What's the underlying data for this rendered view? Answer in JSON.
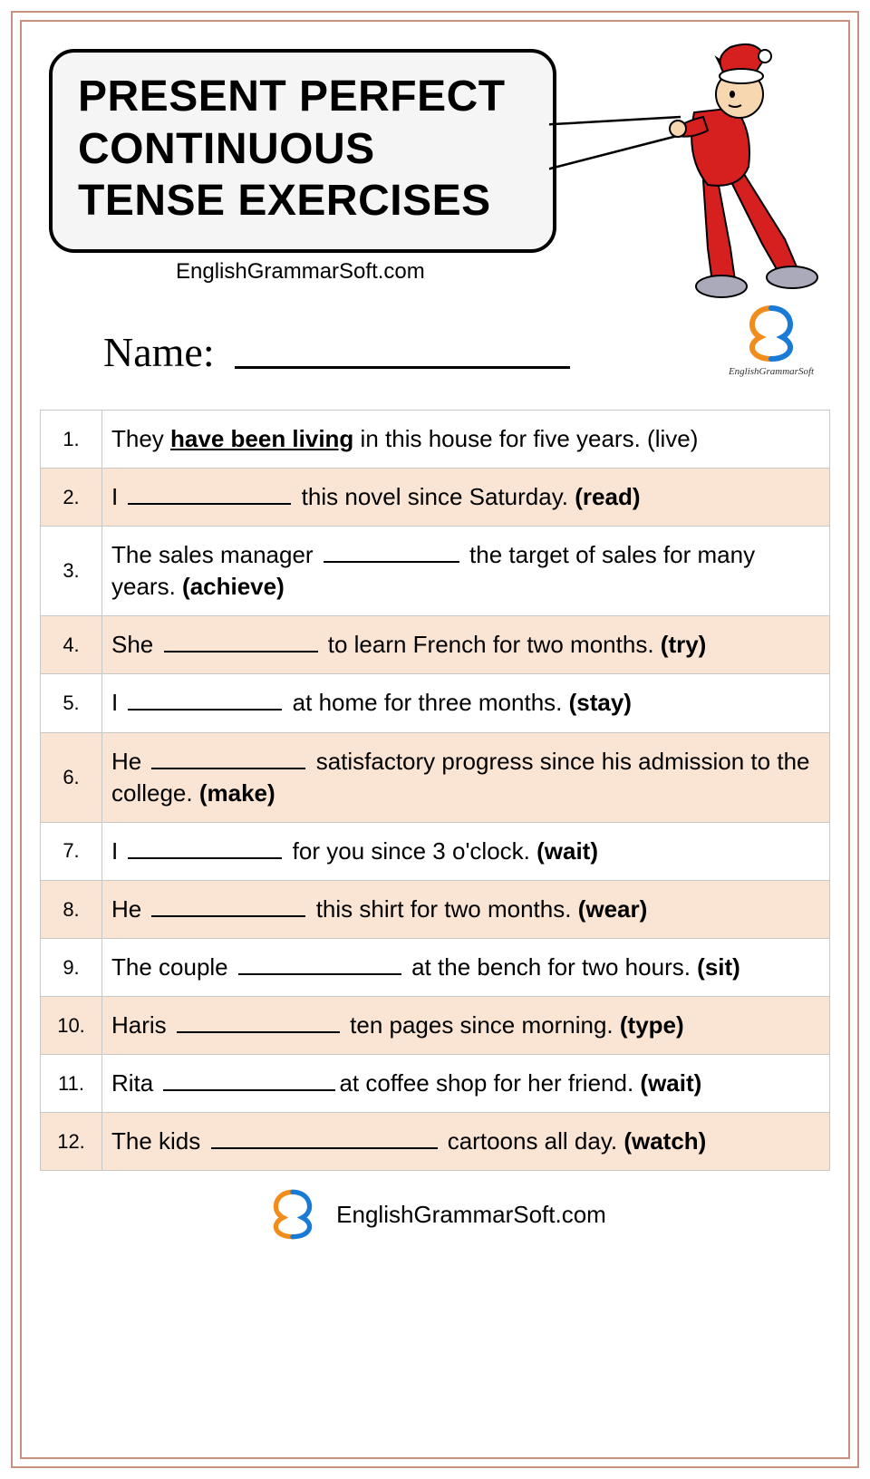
{
  "title": {
    "line1": "PRESENT PERFECT",
    "line2": "CONTINUOUS",
    "line3": "TENSE EXERCISES"
  },
  "website_top": "EnglishGrammarSoft.com",
  "name_label": "Name:",
  "logo_caption": "EnglishGrammarSoft",
  "questions": [
    {
      "n": "1.",
      "pre": "They ",
      "answer": "have been living",
      "post": " in this house for five years. ",
      "verb": "(live)",
      "verb_bold": false,
      "blank_w": 0,
      "example": true
    },
    {
      "n": "2.",
      "pre": "I ",
      "post": " this novel since Saturday. ",
      "verb": "(read)",
      "verb_bold": true,
      "blank_w": 180,
      "example": false
    },
    {
      "n": "3.",
      "pre": "The sales manager ",
      "post": " the target of sales for many years. ",
      "verb": "(achieve)",
      "verb_bold": true,
      "blank_w": 150,
      "example": false
    },
    {
      "n": "4.",
      "pre": "She ",
      "post": " to learn French for two months. ",
      "verb": "(try)",
      "verb_bold": true,
      "blank_w": 170,
      "example": false
    },
    {
      "n": "5.",
      "pre": "I ",
      "post": " at home for three months. ",
      "verb": "(stay)",
      "verb_bold": true,
      "blank_w": 170,
      "example": false
    },
    {
      "n": "6.",
      "pre": "He ",
      "post": " satisfactory progress since his admission to the college. ",
      "verb": "(make)",
      "verb_bold": true,
      "blank_w": 170,
      "example": false
    },
    {
      "n": "7.",
      "pre": "I ",
      "post": " for you since 3 o'clock. ",
      "verb": "(wait)",
      "verb_bold": true,
      "blank_w": 170,
      "example": false
    },
    {
      "n": "8.",
      "pre": "He ",
      "post": " this shirt for two months. ",
      "verb": "(wear)",
      "verb_bold": true,
      "blank_w": 170,
      "example": false
    },
    {
      "n": "9.",
      "pre": "The couple ",
      "post": " at the bench for two hours. ",
      "verb": "(sit)",
      "verb_bold": true,
      "blank_w": 180,
      "example": false
    },
    {
      "n": "10.",
      "pre": "Haris ",
      "post": " ten pages since morning. ",
      "verb": "(type)",
      "verb_bold": true,
      "blank_w": 180,
      "example": false
    },
    {
      "n": "11.",
      "pre": "Rita ",
      "post": "at coffee shop for her friend. ",
      "verb": "(wait)",
      "verb_bold": true,
      "blank_w": 190,
      "example": false
    },
    {
      "n": "12.",
      "pre": "The kids ",
      "post": " cartoons all day. ",
      "verb": "(watch)",
      "verb_bold": true,
      "blank_w": 250,
      "example": false
    }
  ],
  "footer_text": "EnglishGrammarSoft.com"
}
